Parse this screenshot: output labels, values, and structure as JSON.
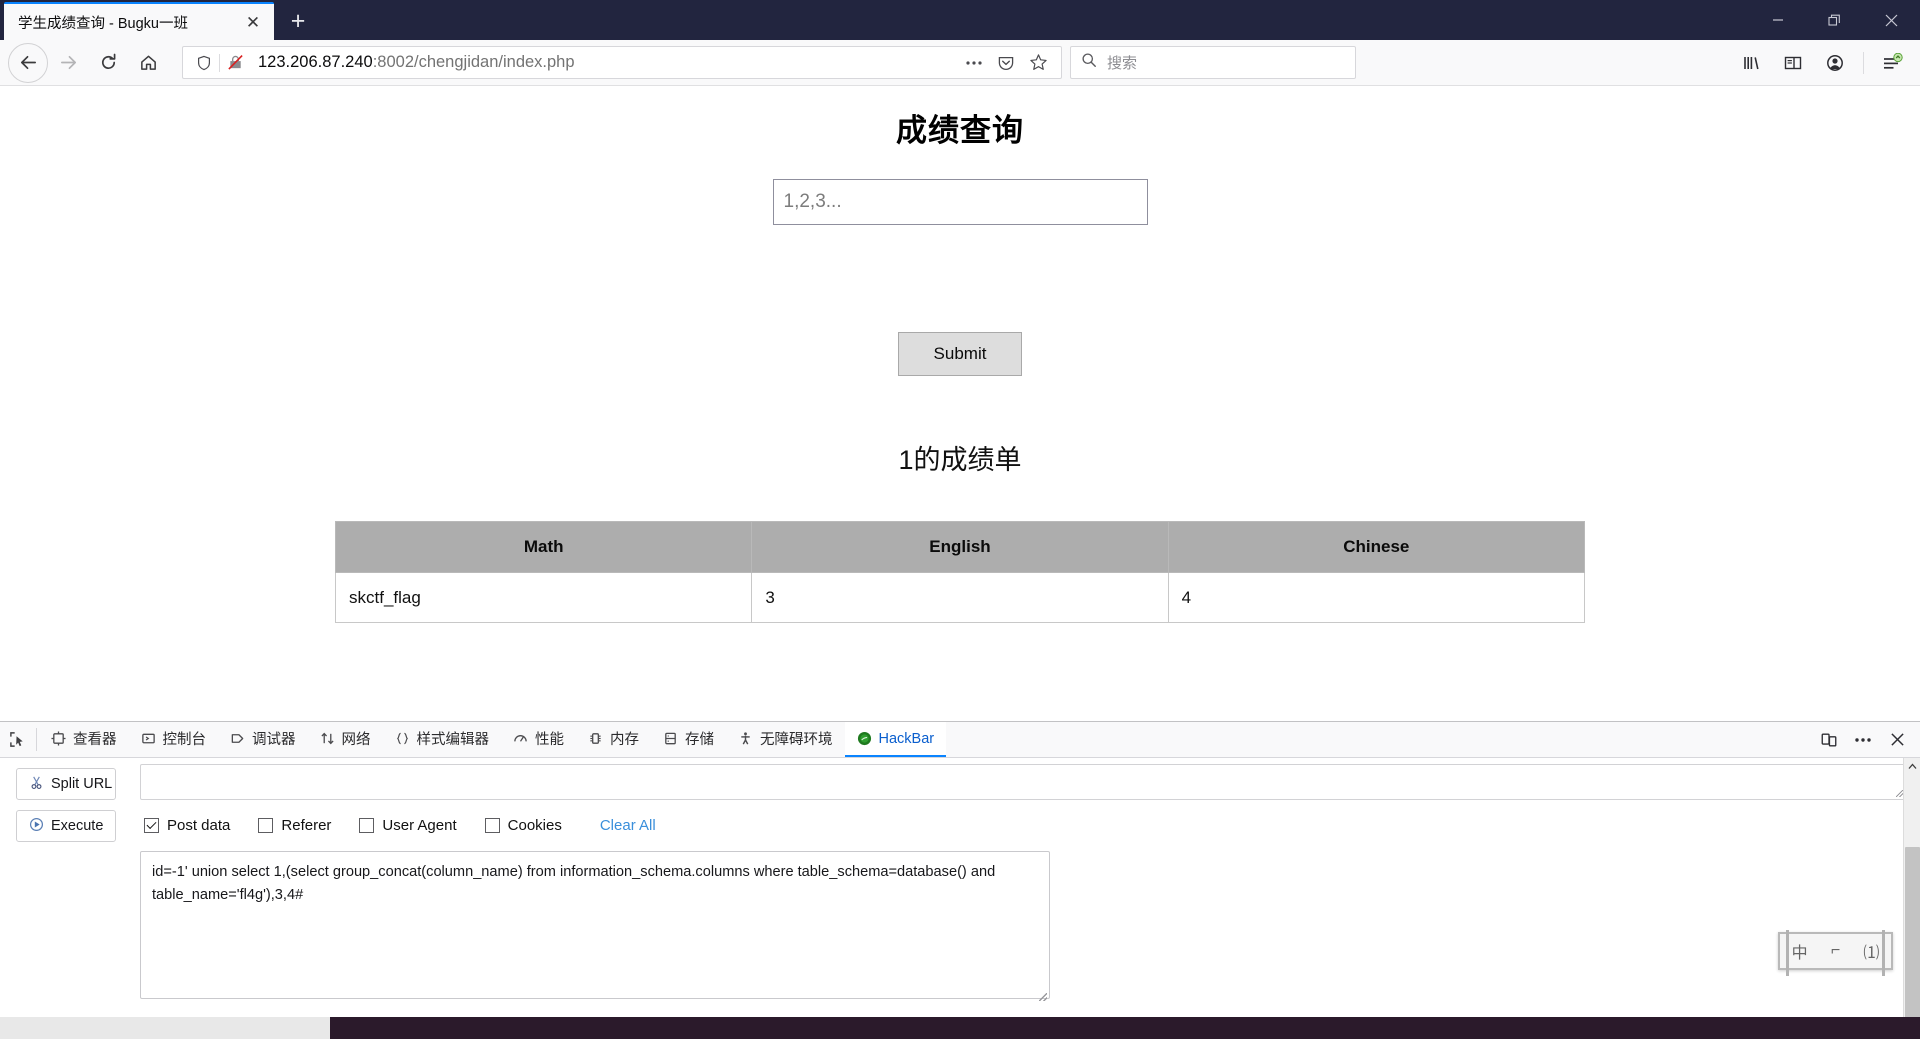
{
  "browser": {
    "tab": {
      "title": "学生成绩查询 - Bugku一班",
      "close_label": "✕"
    },
    "new_tab_label": "+",
    "window_controls": {
      "minimize": "minimize-icon",
      "restore": "restore-icon",
      "close": "close-icon"
    },
    "nav": {
      "back": "back-arrow-icon",
      "forward": "forward-arrow-icon",
      "reload": "reload-icon",
      "home": "home-icon"
    },
    "url": {
      "host": "123.206.87.240",
      "rest": ":8002/chengjidan/index.php",
      "shield_icon": "shield-icon",
      "broken_lock_icon": "broken-lock-icon",
      "page_actions": "ellipsis-icon",
      "pocket": "pocket-icon",
      "bookmark": "star-icon"
    },
    "search": {
      "placeholder": "搜索",
      "icon": "search-icon"
    },
    "toolbar": {
      "library": "library-icon",
      "sidebar": "sidebar-icon",
      "account": "account-icon",
      "menu": "hamburger-menu-icon"
    }
  },
  "page": {
    "title": "成绩查询",
    "input_placeholder": "1,2,3...",
    "input_value": "",
    "submit_label": "Submit",
    "result_title": "1的成绩单",
    "table": {
      "headers": [
        "Math",
        "English",
        "Chinese"
      ],
      "rows": [
        [
          "skctf_flag",
          "3",
          "4"
        ]
      ]
    }
  },
  "devtools": {
    "picker_icon": "element-picker-icon",
    "tabs": [
      {
        "label": "查看器",
        "icon": "inspector-icon",
        "active": false
      },
      {
        "label": "控制台",
        "icon": "console-icon",
        "active": false
      },
      {
        "label": "调试器",
        "icon": "debugger-icon",
        "active": false
      },
      {
        "label": "网络",
        "icon": "network-icon",
        "active": false
      },
      {
        "label": "样式编辑器",
        "icon": "style-editor-icon",
        "active": false
      },
      {
        "label": "性能",
        "icon": "performance-icon",
        "active": false
      },
      {
        "label": "内存",
        "icon": "memory-icon",
        "active": false
      },
      {
        "label": "存储",
        "icon": "storage-icon",
        "active": false
      },
      {
        "label": "无障碍环境",
        "icon": "accessibility-icon",
        "active": false
      },
      {
        "label": "HackBar",
        "icon": "hackbar-icon",
        "active": true
      }
    ],
    "right_buttons": {
      "responsive": "responsive-design-mode-icon",
      "more": "meatball-menu-icon",
      "close": "close-icon"
    }
  },
  "hackbar": {
    "split_url_label": "Split URL",
    "split_url_icon": "scissors-icon",
    "execute_label": "Execute",
    "execute_icon": "play-icon",
    "url_value": "",
    "options": [
      {
        "label": "Post data",
        "checked": true
      },
      {
        "label": "Referer",
        "checked": false
      },
      {
        "label": "User Agent",
        "checked": false
      },
      {
        "label": "Cookies",
        "checked": false
      }
    ],
    "clear_all_label": "Clear All",
    "post_data": "id=-1' union select 1,(select group_concat(column_name) from information_schema.columns where table_schema=database() and table_name='fl4g'),3,4#"
  },
  "ime": {
    "cells": [
      "中",
      "⌐",
      "⑴"
    ]
  },
  "taskbar": {
    "window_label": "",
    "clock": ""
  },
  "colors": {
    "titlebar": "#22253f",
    "accent": "#0a84ff",
    "link": "#3a8fdb",
    "table_header": "#adadad",
    "button_face": "#dddddd"
  }
}
